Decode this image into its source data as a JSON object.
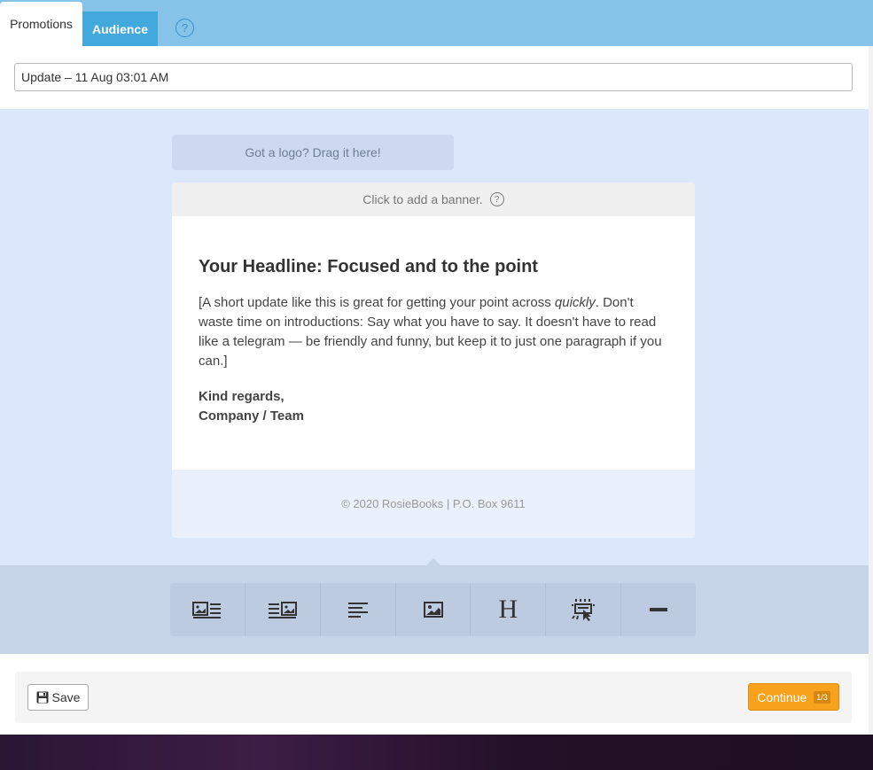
{
  "tabs": [
    {
      "label": "Promotions"
    },
    {
      "label": "Audience"
    }
  ],
  "help_icon": "?",
  "title_input": {
    "value": "Update – 11 Aug 03:01 AM"
  },
  "logo_drop": {
    "label": "Got a logo? Drag it here!"
  },
  "banner": {
    "label": "Click to add a banner.",
    "help": "?"
  },
  "email": {
    "headline": "Your Headline: Focused and to the point",
    "paragraph_before": "[A short update like this is great for getting your point across ",
    "paragraph_em": "quickly",
    "paragraph_after": ". Don't waste time on introductions: Say what you have to say. It doesn't have to read like a telegram — be friendly and funny, but keep it to just one paragraph if you can.]",
    "signoff_line1": "Kind regards,",
    "signoff_line2": "Company / Team",
    "footer": "© 2020 RosieBooks | P.O. Box 9611"
  },
  "palette": {
    "icons": [
      "image-left-text-icon",
      "text-image-right-icon",
      "text-block-icon",
      "image-block-icon",
      "heading-icon",
      "button-block-icon",
      "divider-icon"
    ],
    "heading_glyph": "H"
  },
  "actions": {
    "save_label": "Save",
    "continue_label": "Continue",
    "step": "1/3"
  },
  "colors": {
    "tabbar": "#85c3e8",
    "active_tab": "#42a9dc",
    "canvas": "#dbe7fb",
    "continue": "#f8a11c"
  }
}
